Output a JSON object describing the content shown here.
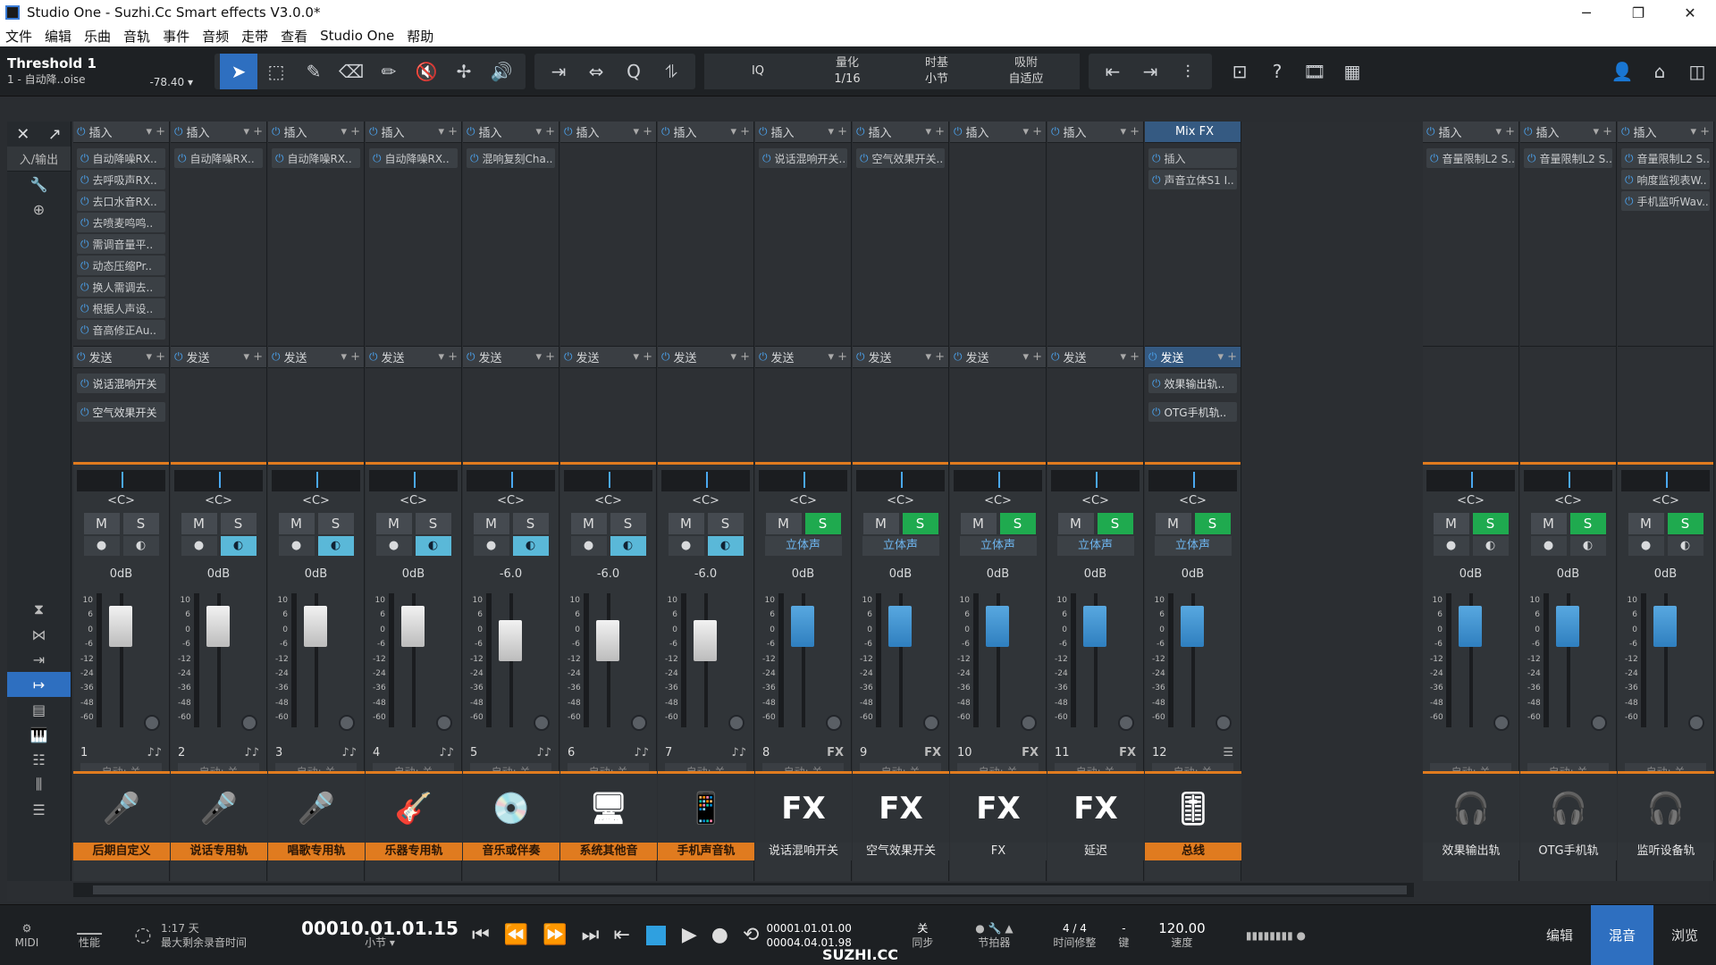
{
  "window": {
    "title": "Studio One - Suzhi.Cc Smart effects V3.0.0*",
    "controls": [
      "─",
      "❐",
      "✕"
    ]
  },
  "menu": [
    "文件",
    "编辑",
    "乐曲",
    "音轨",
    "事件",
    "音频",
    "走带",
    "查看",
    "Studio One",
    "帮助"
  ],
  "toolbar": {
    "track_name": "Threshold 1",
    "track_sub": "1 - 自动降..oise",
    "track_value": "-78.40 ▾",
    "iq": "IQ",
    "quant_label": "量化",
    "quant_value": "1/16",
    "timebase_label": "时基",
    "timebase_value": "小节",
    "snap_label": "吸附",
    "snap_value": "自适应",
    "help": "?"
  },
  "sidebar": {
    "io_label": "入/输出"
  },
  "strip_labels": {
    "insert": "插入",
    "send": "发送",
    "mixfx": "Mix FX",
    "auto": "自动: 关",
    "m": "M",
    "s": "S",
    "stereo": "立体声",
    "pan": "<C>"
  },
  "channels": [
    {
      "num": "1",
      "name": "后期自定义",
      "vol": "0dB",
      "inserts": [
        "自动降噪RX..",
        "去呼吸声RX..",
        "去口水音RX..",
        "去喷麦鸣鸣..",
        "需调音量平..",
        "动态压缩Pr..",
        "换人需调去..",
        "根据人声设..",
        "音高修正Au.."
      ],
      "sends": [
        "说话混响开关",
        "空气效果开关"
      ],
      "tail": "♪♪",
      "icon": "🎤",
      "mon": true
    },
    {
      "num": "2",
      "name": "说话专用轨",
      "vol": "0dB",
      "inserts": [
        "自动降噪RX.."
      ],
      "sends": [],
      "tail": "♪♪",
      "icon": "🎤",
      "mon": true
    },
    {
      "num": "3",
      "name": "唱歌专用轨",
      "vol": "0dB",
      "inserts": [
        "自动降噪RX.."
      ],
      "sends": [],
      "tail": "♪♪",
      "icon": "🎤",
      "mon": true
    },
    {
      "num": "4",
      "name": "乐器专用轨",
      "vol": "0dB",
      "inserts": [
        "自动降噪RX.."
      ],
      "sends": [],
      "tail": "♪♪",
      "icon": "🎸",
      "mon": true
    },
    {
      "num": "5",
      "name": "音乐或伴奏",
      "vol": "-6.0",
      "inserts": [
        "混响复刻Cha.."
      ],
      "sends": [],
      "tail": "♪♪",
      "icon": "💿",
      "mon": true
    },
    {
      "num": "6",
      "name": "系统其他音",
      "vol": "-6.0",
      "inserts": [],
      "sends": [],
      "tail": "♪♪",
      "icon": "🖥",
      "mon": true
    },
    {
      "num": "7",
      "name": "手机声音轨",
      "vol": "-6.0",
      "inserts": [],
      "sends": [],
      "tail": "♪♪",
      "icon": "📱",
      "mon": true
    },
    {
      "num": "8",
      "name": "说话混响开关",
      "vol": "0dB",
      "inserts": [
        "说话混响开关.."
      ],
      "sends": [],
      "tail": "FX",
      "icon": "FX",
      "fx": true
    },
    {
      "num": "9",
      "name": "空气效果开关",
      "vol": "0dB",
      "inserts": [
        "空气效果开关.."
      ],
      "sends": [],
      "tail": "FX",
      "icon": "FX",
      "fx": true
    },
    {
      "num": "10",
      "name": "FX",
      "vol": "0dB",
      "inserts": [],
      "sends": [],
      "tail": "FX",
      "icon": "FX",
      "fx": true
    },
    {
      "num": "11",
      "name": "延迟",
      "vol": "0dB",
      "inserts": [],
      "sends": [],
      "tail": "FX",
      "icon": "FX",
      "fx": true
    },
    {
      "num": "12",
      "name": "总线",
      "vol": "0dB",
      "inserts": [
        "声音立体S1 I.."
      ],
      "sends": [
        "效果输出轨..",
        "OTG手机轨.."
      ],
      "tail": "☰",
      "icon": "🎚",
      "fx": true,
      "bus": true
    }
  ],
  "outputs": [
    {
      "name": "效果输出轨",
      "vol": "0dB",
      "inserts": [
        "音量限制L2 S.."
      ],
      "icon": "🎧"
    },
    {
      "name": "OTG手机轨",
      "vol": "0dB",
      "inserts": [
        "音量限制L2 S.."
      ],
      "icon": "🎧"
    },
    {
      "name": "监听设备轨",
      "vol": "0dB",
      "inserts": [
        "音量限制L2 S..",
        "响度监视表W..",
        "手机监听Wav.."
      ],
      "icon": "🎧"
    }
  ],
  "transport": {
    "midi": "MIDI",
    "perf": "性能",
    "record_time": "1:17 天",
    "record_label": "最大剩余录音时间",
    "position": "00010.01.01.15",
    "position_unit": "小节 ▾",
    "loop_start": "00001.01.01.00",
    "loop_end": "00004.04.01.98",
    "sync": "关",
    "sync_label": "同步",
    "metronome_label": "节拍器",
    "timesig": "4 / 4",
    "timesig_label": "时间修整",
    "key": "-",
    "key_label": "键",
    "tempo": "120.00",
    "tempo_label": "速度",
    "watermark": "SUZHI.CC",
    "modes": [
      "编辑",
      "混音",
      "浏览"
    ]
  }
}
